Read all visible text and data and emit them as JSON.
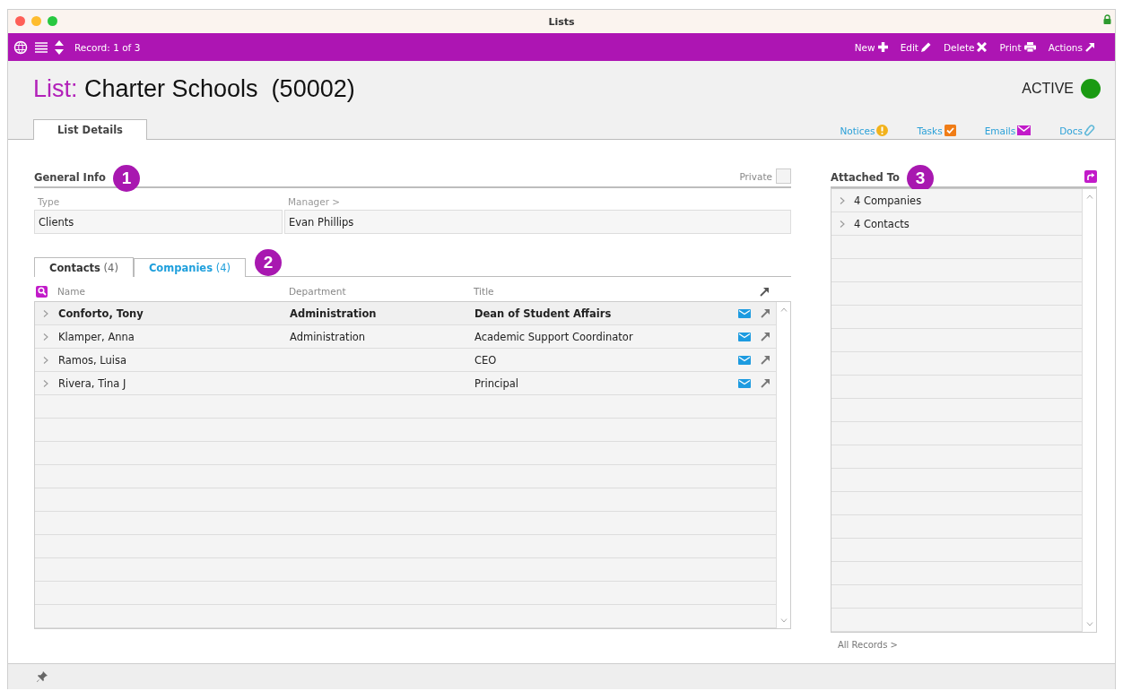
{
  "window": {
    "title": "Lists"
  },
  "toolbar": {
    "record": "Record: 1 of 3",
    "actions": [
      {
        "label": "New",
        "kind": "plus"
      },
      {
        "label": "Edit",
        "kind": "pencil"
      },
      {
        "label": "Delete",
        "kind": "cross"
      },
      {
        "label": "Print",
        "kind": "printer"
      },
      {
        "label": "Actions",
        "kind": "arrow"
      }
    ]
  },
  "header": {
    "prefix": "List:",
    "title": "Charter Schools  (50002)",
    "status": "ACTIVE"
  },
  "tabs": [
    {
      "label": "List Details",
      "selected": true
    }
  ],
  "links": [
    {
      "label": "Notices",
      "kind": "notice"
    },
    {
      "label": "Tasks",
      "kind": "task"
    },
    {
      "label": "Emails",
      "kind": "email"
    },
    {
      "label": "Docs",
      "kind": "clip"
    }
  ],
  "general_info": {
    "heading": "General Info",
    "callout": "1",
    "private_label": "Private",
    "private": false,
    "fields": [
      {
        "label": "Type",
        "value": "Clients"
      },
      {
        "label": "Manager >",
        "value": "Evan Phillips"
      }
    ]
  },
  "subtabs": {
    "callout": "2",
    "items": [
      {
        "label": "Contacts",
        "count": "(4)",
        "selected": true
      },
      {
        "label": "Companies",
        "count": "(4)",
        "selected": false
      }
    ]
  },
  "contacts": {
    "columns": [
      "Name",
      "Department",
      "Title"
    ],
    "rows": [
      {
        "name": "Conforto, Tony",
        "department": "Administration",
        "title": "Dean of Student Affairs",
        "selected": true
      },
      {
        "name": "Klamper, Anna",
        "department": "Administration",
        "title": "Academic Support Coordinator",
        "selected": false
      },
      {
        "name": "Ramos, Luisa",
        "department": "",
        "title": "CEO",
        "selected": false
      },
      {
        "name": "Rivera, Tina J",
        "department": "",
        "title": "Principal",
        "selected": false
      }
    ]
  },
  "attached": {
    "heading": "Attached To",
    "callout": "3",
    "items": [
      "4 Companies",
      "4 Contacts"
    ],
    "footer_link": "All Records >"
  }
}
